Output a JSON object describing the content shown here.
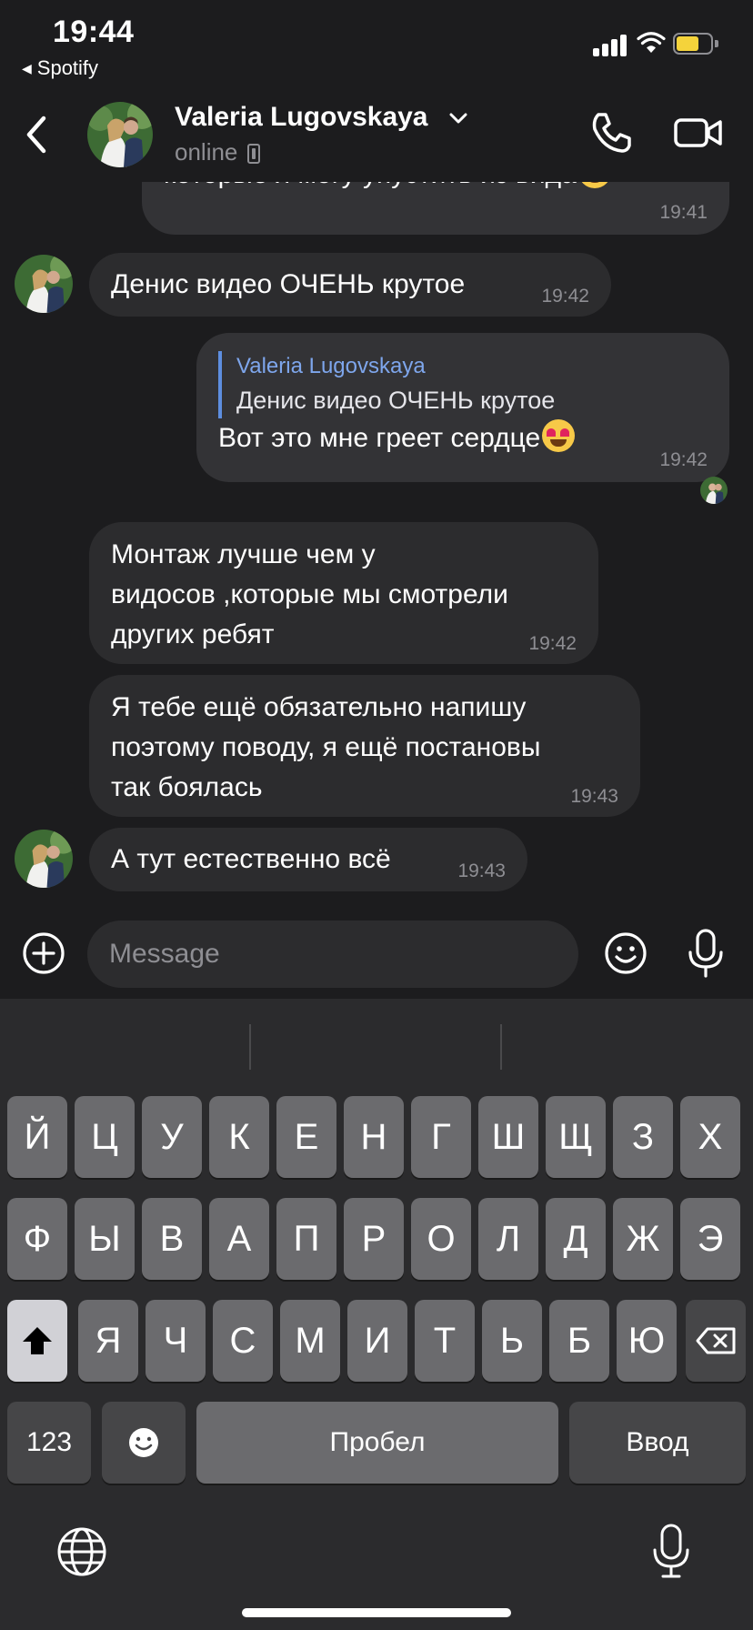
{
  "status_bar": {
    "time": "19:44",
    "back_app": "Spotify",
    "battery_color": "#f5d33b"
  },
  "header": {
    "contact_name": "Valeria Lugovskaya",
    "presence": "online",
    "icons": [
      "back-chevron-icon",
      "chevron-down-icon",
      "phone-icon",
      "video-camera-icon"
    ]
  },
  "messages": [
    {
      "direction": "out",
      "text": "которые я могу упустить из вида",
      "emoji": "smiling-face",
      "time": "19:41"
    },
    {
      "direction": "in",
      "text": "Денис видео ОЧЕНЬ крутое",
      "time": "19:42"
    },
    {
      "direction": "out",
      "reply_to_name": "Valeria Lugovskaya",
      "reply_to_text": "Денис видео ОЧЕНЬ крутое",
      "text": "Вот это мне греет сердце",
      "emoji": "heart-eyes-face",
      "time": "19:42"
    },
    {
      "direction": "in",
      "text": "Монтаж лучше чем у\nвидосов ,которые мы смотрели\nдругих ребят",
      "time": "19:42"
    },
    {
      "direction": "in",
      "text": "Я тебе ещё обязательно напишу\nпоэтому поводу,  я ещё постановы\nтак боялась",
      "time": "19:43"
    },
    {
      "direction": "in",
      "text": "А тут естественно всё",
      "time": "19:43"
    }
  ],
  "composer": {
    "placeholder": "Message"
  },
  "keyboard": {
    "row1": [
      "Й",
      "Ц",
      "У",
      "К",
      "Е",
      "Н",
      "Г",
      "Ш",
      "Щ",
      "З",
      "Х"
    ],
    "row2": [
      "Ф",
      "Ы",
      "В",
      "А",
      "П",
      "Р",
      "О",
      "Л",
      "Д",
      "Ж",
      "Э"
    ],
    "row3": [
      "Я",
      "Ч",
      "С",
      "М",
      "И",
      "Т",
      "Ь",
      "Б",
      "Ю"
    ],
    "numbers_key": "123",
    "space_key": "Пробел",
    "return_key": "Ввод"
  }
}
